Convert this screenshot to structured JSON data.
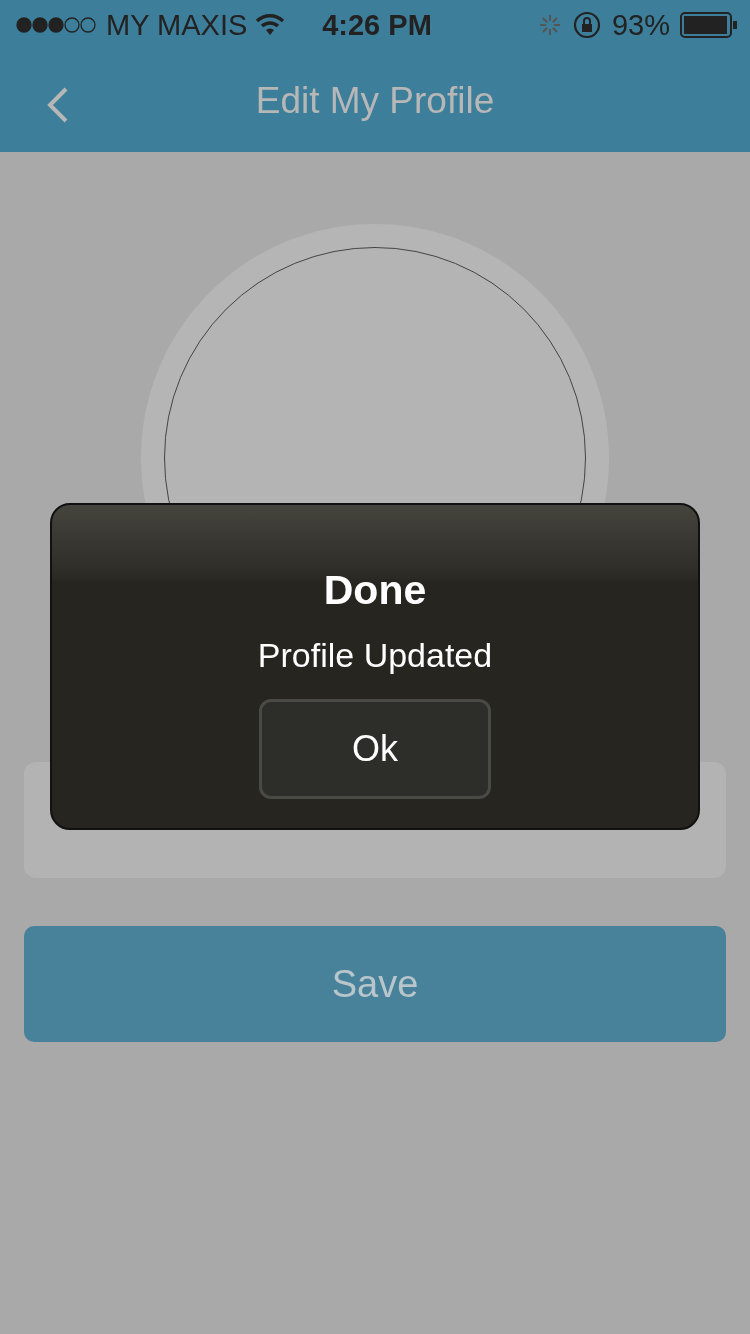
{
  "status_bar": {
    "carrier": "MY MAXIS",
    "time": "4:26 PM",
    "battery": "93%"
  },
  "nav_bar": {
    "title": "Edit My Profile"
  },
  "form": {
    "save_button": "Save"
  },
  "alert": {
    "title": "Done",
    "message": "Profile Updated",
    "button": "Ok"
  }
}
